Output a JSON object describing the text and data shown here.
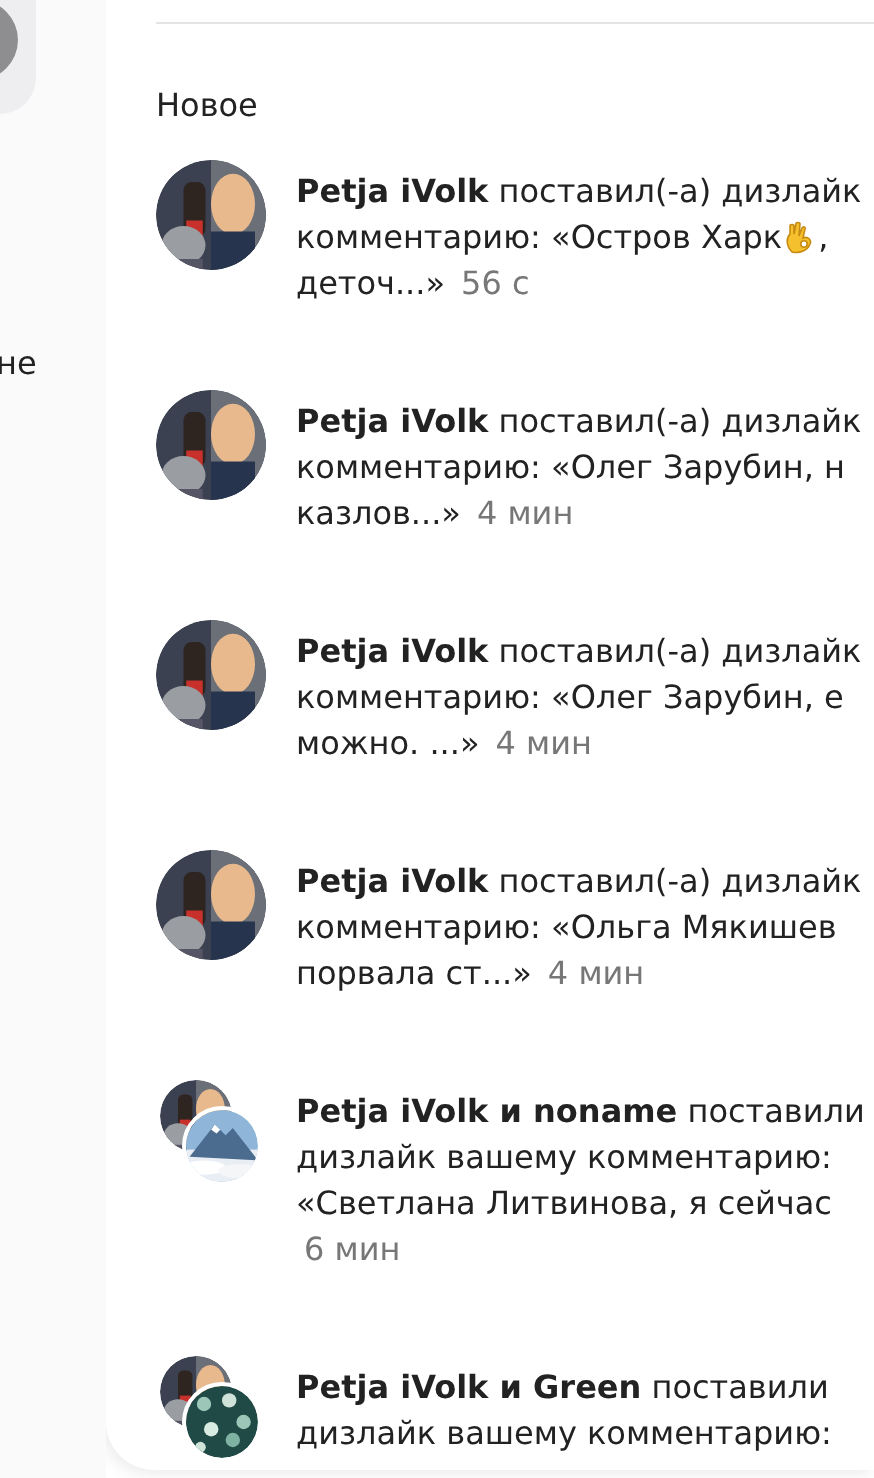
{
  "sidebar": {
    "label": "не"
  },
  "section_title": "Новое",
  "notifications": [
    {
      "kind": "single",
      "lines": [
        "**Petja iVolk** поставил(-а) дизлайк",
        [
          {
            "kind": "text",
            "text": "комментарию: «Остров Харк"
          },
          {
            "kind": "ok-hand"
          },
          {
            "kind": "text",
            "text": ","
          }
        ],
        "деточ...»"
      ],
      "time": "56 с",
      "time_on_new_line": false
    },
    {
      "kind": "single",
      "lines": [
        "**Petja iVolk** поставил(-а) дизлайк",
        "комментарию: «Олег Зарубин, н",
        "казлов...»"
      ],
      "time": "4 мин",
      "time_on_new_line": false
    },
    {
      "kind": "single",
      "lines": [
        "**Petja iVolk** поставил(-а) дизлайк",
        "комментарию: «Олег Зарубин, е",
        "можно. ...»"
      ],
      "time": "4 мин",
      "time_on_new_line": false
    },
    {
      "kind": "single",
      "lines": [
        "**Petja iVolk** поставил(-а) дизлайк",
        "комментарию: «Ольга Мякишев",
        "порвала ст...»"
      ],
      "time": "4 мин",
      "time_on_new_line": false
    },
    {
      "kind": "pair",
      "lines": [
        "**Petja iVolk и noname** поставили",
        "дизлайк вашему комментарию:",
        "«Светлана Литвинова, я сейчас"
      ],
      "time": "6 мин",
      "time_on_new_line": true
    },
    {
      "kind": "pair",
      "lines": [
        "**Petja iVolk и Green** поставили",
        "дизлайк вашему комментарию:"
      ]
    }
  ]
}
